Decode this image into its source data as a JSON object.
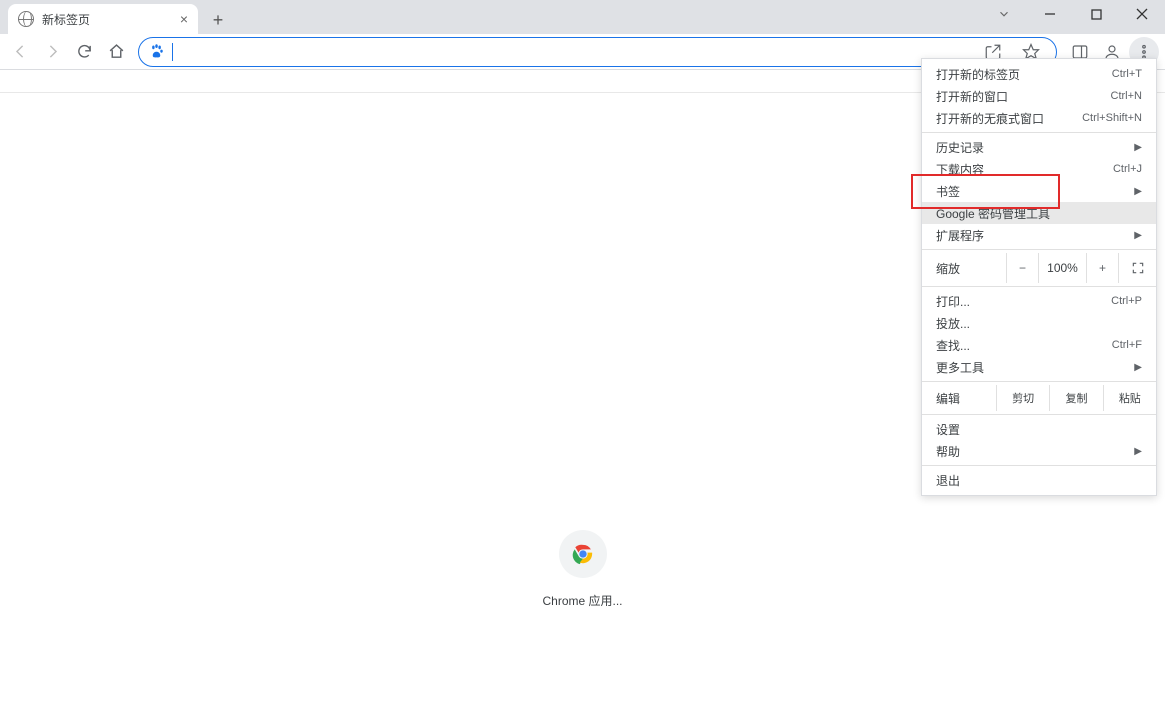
{
  "tab": {
    "title": "新标签页"
  },
  "menu": {
    "new_tab": {
      "label": "打开新的标签页",
      "shortcut": "Ctrl+T"
    },
    "new_window": {
      "label": "打开新的窗口",
      "shortcut": "Ctrl+N"
    },
    "new_incognito": {
      "label": "打开新的无痕式窗口",
      "shortcut": "Ctrl+Shift+N"
    },
    "history": {
      "label": "历史记录"
    },
    "downloads": {
      "label": "下载内容",
      "shortcut": "Ctrl+J"
    },
    "bookmarks": {
      "label": "书签"
    },
    "password_manager": {
      "label": "Google 密码管理工具"
    },
    "extensions": {
      "label": "扩展程序"
    },
    "zoom": {
      "label": "缩放",
      "value": "100%",
      "minus": "−",
      "plus": "+"
    },
    "print": {
      "label": "打印...",
      "shortcut": "Ctrl+P"
    },
    "cast": {
      "label": "投放..."
    },
    "find": {
      "label": "查找...",
      "shortcut": "Ctrl+F"
    },
    "more_tools": {
      "label": "更多工具"
    },
    "edit": {
      "label": "编辑",
      "cut": "剪切",
      "copy": "复制",
      "paste": "粘贴"
    },
    "settings": {
      "label": "设置"
    },
    "help": {
      "label": "帮助"
    },
    "exit": {
      "label": "退出"
    }
  },
  "content": {
    "shortcut_label": "Chrome 应用..."
  }
}
